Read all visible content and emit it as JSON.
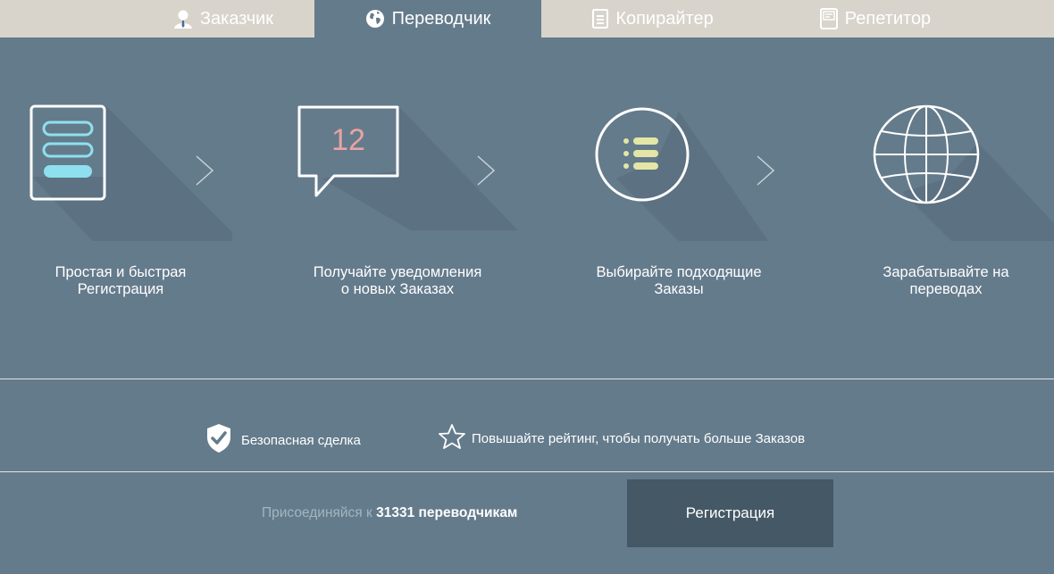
{
  "tabs": [
    {
      "label": "Заказчик",
      "icon": "user-icon",
      "active": false
    },
    {
      "label": "Переводчик",
      "icon": "globe-icon",
      "active": true
    },
    {
      "label": "Копирайтер",
      "icon": "document-icon",
      "active": false
    },
    {
      "label": "Репетитор",
      "icon": "notebook-icon",
      "active": false
    }
  ],
  "steps": [
    {
      "icon": "form-icon",
      "line1": "Простая и быстрая",
      "line2": "Регистрация"
    },
    {
      "icon": "notification-icon",
      "badge": "12",
      "line1": "Получайте уведомления",
      "line2": "о новых Заказах"
    },
    {
      "icon": "list-icon",
      "line1": "Выбирайте подходящие",
      "line2": "Заказы"
    },
    {
      "icon": "globe-icon",
      "line1": "Зарабатывайте на",
      "line2": "переводах"
    }
  ],
  "features": [
    {
      "icon": "shield-check-icon",
      "label": "Безопасная сделка"
    },
    {
      "icon": "star-icon",
      "label": "Повышайте рейтинг, чтобы получать больше Заказов"
    }
  ],
  "join": {
    "prefix": "Присоединяйся к",
    "count": "31331",
    "suffix": "переводчикам"
  },
  "register_button": "Регистрация",
  "colors": {
    "background": "#647b8b",
    "tabbar": "#d8d4cb",
    "button": "#455866",
    "accent_cyan": "#8fe0ee",
    "badge_pink": "#e8a3a3",
    "list_yellow": "#e3e6a6"
  }
}
